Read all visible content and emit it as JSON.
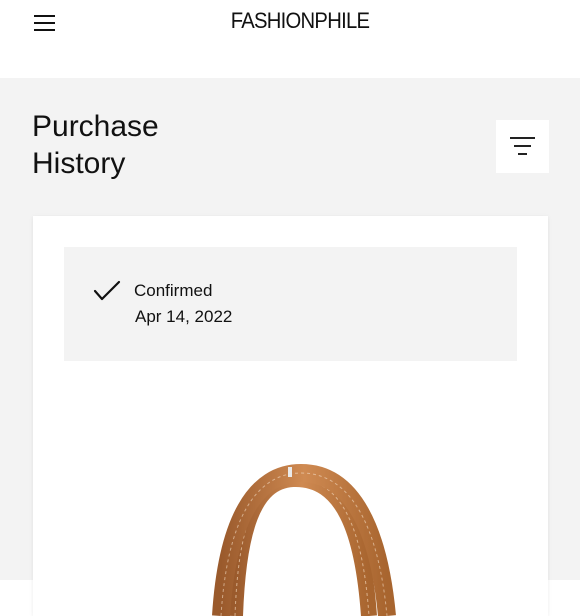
{
  "header": {
    "brand": "FASHIONPHILE",
    "menu_icon": "hamburger-menu-icon"
  },
  "page": {
    "title_line1": "Purchase",
    "title_line2": "History",
    "filter_icon": "filter-icon"
  },
  "order": {
    "status": "Confirmed",
    "date": "Apr 14, 2022",
    "status_icon": "checkmark-icon",
    "product_image": "tote-bag-photo"
  },
  "colors": {
    "page_background": "#f3f3f3",
    "card_background": "#ffffff",
    "leather_tan": "#c17a45"
  }
}
